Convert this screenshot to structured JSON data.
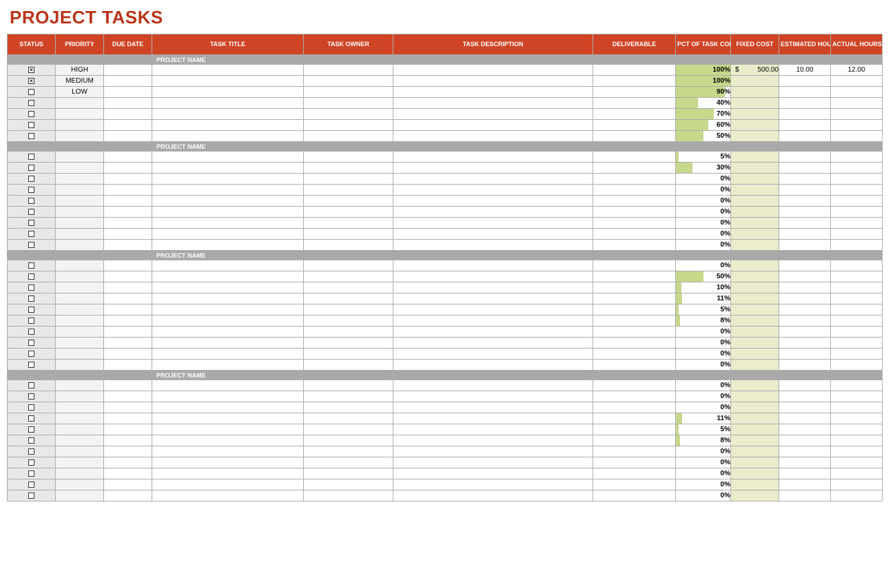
{
  "title": "PROJECT TASKS",
  "columns": {
    "status": "STATUS",
    "priority": "PRIORITY",
    "due": "DUE DATE",
    "title": "TASK TITLE",
    "owner": "TASK OWNER",
    "desc": "TASK DESCRIPTION",
    "deliverable": "DELIVERABLE",
    "pct": "PCT OF TASK COMPLETE",
    "cost": "FIXED COST",
    "est": "ESTIMATED HOURS",
    "act": "ACTUAL HOURS"
  },
  "groups": [
    {
      "name": "PROJECT NAME",
      "rows": [
        {
          "checked": true,
          "priority": "HIGH",
          "pct": 100,
          "cost": "500.00",
          "est": "10.00",
          "act": "12.00"
        },
        {
          "checked": true,
          "priority": "MEDIUM",
          "pct": 100
        },
        {
          "checked": false,
          "priority": "LOW",
          "pct": 90
        },
        {
          "checked": false,
          "pct": 40
        },
        {
          "checked": false,
          "pct": 70
        },
        {
          "checked": false,
          "pct": 60
        },
        {
          "checked": false,
          "pct": 50
        }
      ]
    },
    {
      "name": "PROJECT NAME",
      "rows": [
        {
          "checked": false,
          "pct": 5
        },
        {
          "checked": false,
          "pct": 30
        },
        {
          "checked": false,
          "pct": 0
        },
        {
          "checked": false,
          "pct": 0
        },
        {
          "checked": false,
          "pct": 0
        },
        {
          "checked": false,
          "pct": 0
        },
        {
          "checked": false,
          "pct": 0
        },
        {
          "checked": false,
          "pct": 0
        },
        {
          "checked": false,
          "pct": 0
        }
      ]
    },
    {
      "name": "PROJECT NAME",
      "rows": [
        {
          "checked": false,
          "pct": 0
        },
        {
          "checked": false,
          "pct": 50
        },
        {
          "checked": false,
          "pct": 10
        },
        {
          "checked": false,
          "pct": 11
        },
        {
          "checked": false,
          "pct": 5
        },
        {
          "checked": false,
          "pct": 8
        },
        {
          "checked": false,
          "pct": 0
        },
        {
          "checked": false,
          "pct": 0
        },
        {
          "checked": false,
          "pct": 0
        },
        {
          "checked": false,
          "pct": 0
        }
      ]
    },
    {
      "name": "PROJECT NAME",
      "rows": [
        {
          "checked": false,
          "pct": 0
        },
        {
          "checked": false,
          "pct": 0
        },
        {
          "checked": false,
          "pct": 0
        },
        {
          "checked": false,
          "pct": 11
        },
        {
          "checked": false,
          "pct": 5
        },
        {
          "checked": false,
          "pct": 8
        },
        {
          "checked": false,
          "pct": 0
        },
        {
          "checked": false,
          "pct": 0
        },
        {
          "checked": false,
          "pct": 0
        },
        {
          "checked": false,
          "pct": 0
        },
        {
          "checked": false,
          "pct": 0
        }
      ]
    }
  ]
}
